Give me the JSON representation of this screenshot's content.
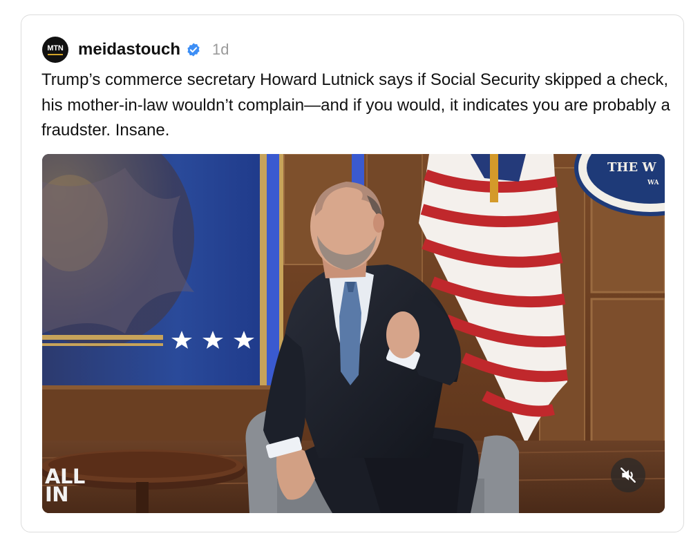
{
  "post": {
    "avatar_text": "MTN",
    "username": "meidastouch",
    "verified": true,
    "time": "1d",
    "caption": "Trump’s commerce secretary Howard Lutnick says if Social Security skipped a check, his mother-in-law wouldn’t complain—and if you would, it indicates you are probably a fraudster. Insane."
  },
  "video": {
    "watermark": "ALL\nIN",
    "seal_text": "THE W",
    "seal_subtext": "WA",
    "muted": true
  },
  "colors": {
    "verified_badge": "#3d8ef5",
    "time_gray": "#9a9a9a"
  }
}
